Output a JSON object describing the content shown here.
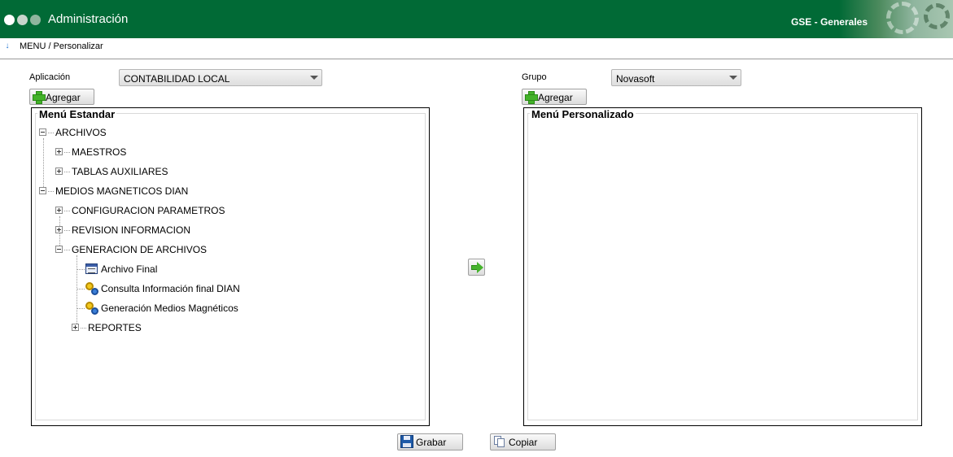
{
  "header": {
    "app_title": "Administración",
    "module_label": "GSE - Generales",
    "color": "#016a36"
  },
  "breadcrumb": {
    "text": "MENU / Personalizar",
    "icon": "info-arrow-icon"
  },
  "left": {
    "application_label": "Aplicación",
    "application_value": "CONTABILIDAD LOCAL",
    "add_label": "Agregar",
    "panel_title": "Menú Estandar",
    "tree": [
      {
        "label": "ARCHIVOS",
        "expander": "minus"
      },
      {
        "label": "MAESTROS",
        "expander": "plus"
      },
      {
        "label": "TABLAS AUXILIARES",
        "expander": "plus"
      },
      {
        "label": "MEDIOS MAGNETICOS DIAN",
        "expander": "minus"
      },
      {
        "label": "CONFIGURACION PARAMETROS",
        "expander": "plus"
      },
      {
        "label": "REVISION INFORMACION",
        "expander": "plus"
      },
      {
        "label": "GENERACION DE ARCHIVOS",
        "expander": "minus"
      },
      {
        "label": "Archivo Final",
        "icon": "form-icon"
      },
      {
        "label": "Consulta Información final DIAN",
        "icon": "gears-icon"
      },
      {
        "label": "Generación Medios Magnéticos",
        "icon": "gears-icon"
      },
      {
        "label": "REPORTES",
        "expander": "plus"
      }
    ]
  },
  "right": {
    "group_label": "Grupo",
    "group_value": "Novasoft",
    "add_label": "Agregar",
    "panel_title": "Menú Personalizado"
  },
  "actions": {
    "move_icon": "arrow-right-icon",
    "save_label": "Grabar",
    "copy_label": "Copiar"
  }
}
